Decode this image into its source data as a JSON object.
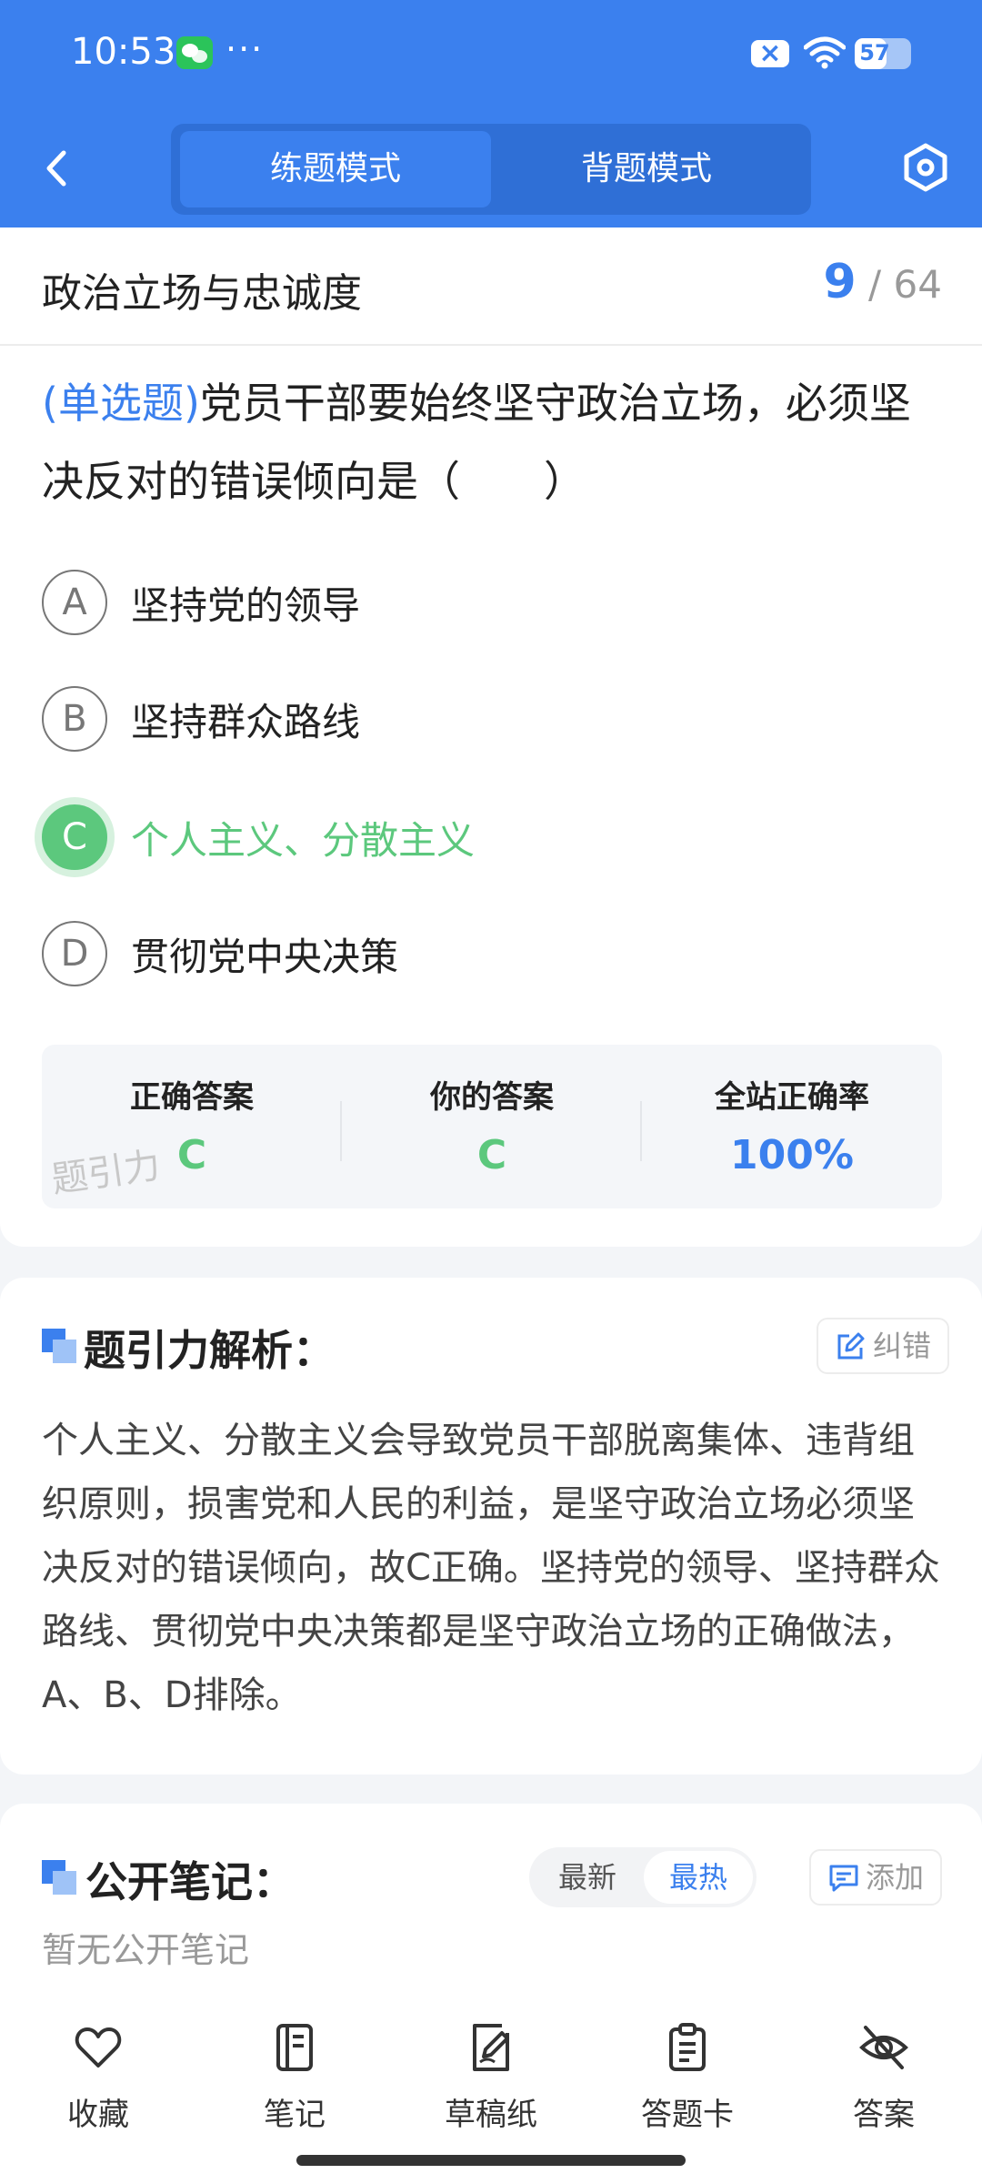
{
  "status_bar": {
    "time": "10:53",
    "more": "···",
    "notif_badge": "×",
    "battery": "57",
    "battery_level": 0.57
  },
  "nav": {
    "mode_practice": "练题模式",
    "mode_memorize": "背题模式"
  },
  "question": {
    "chapter": "政治立场与忠诚度",
    "current": "9",
    "total": "/ 64",
    "type": "(单选题)",
    "text": "党员干部要始终坚守政治立场，必须坚决反对的错误倾向是（　　）",
    "options": [
      {
        "letter": "A",
        "text": "坚持党的领导"
      },
      {
        "letter": "B",
        "text": "坚持群众路线"
      },
      {
        "letter": "C",
        "text": "个人主义、分散主义"
      },
      {
        "letter": "D",
        "text": "贯彻党中央决策"
      }
    ],
    "selected": "C"
  },
  "stats": {
    "correct_label": "正确答案",
    "correct_value": "C",
    "yours_label": "你的答案",
    "yours_value": "C",
    "rate_label": "全站正确率",
    "rate_value": "100%",
    "watermark": "题引力"
  },
  "analysis": {
    "title": "题引力解析：",
    "report_label": "纠错",
    "text": "个人主义、分散主义会导致党员干部脱离集体、违背组织原则，损害党和人民的利益，是坚守政治立场必须坚决反对的错误倾向，故C正确。坚持党的领导、坚持群众路线、贯彻党中央决策都是坚守政治立场的正确做法，A、B、D排除。"
  },
  "notes": {
    "title": "公开笔记：",
    "sort_latest": "最新",
    "sort_hot": "最热",
    "add_label": "添加",
    "empty": "暂无公开笔记"
  },
  "bottom_tabs": [
    {
      "label": "收藏",
      "icon": "heart-icon"
    },
    {
      "label": "笔记",
      "icon": "notebook-icon"
    },
    {
      "label": "草稿纸",
      "icon": "draft-icon"
    },
    {
      "label": "答题卡",
      "icon": "clipboard-icon"
    },
    {
      "label": "答案",
      "icon": "eye-off-icon"
    }
  ],
  "colors": {
    "primary": "#3b80ee",
    "correct": "#5cc87d"
  }
}
